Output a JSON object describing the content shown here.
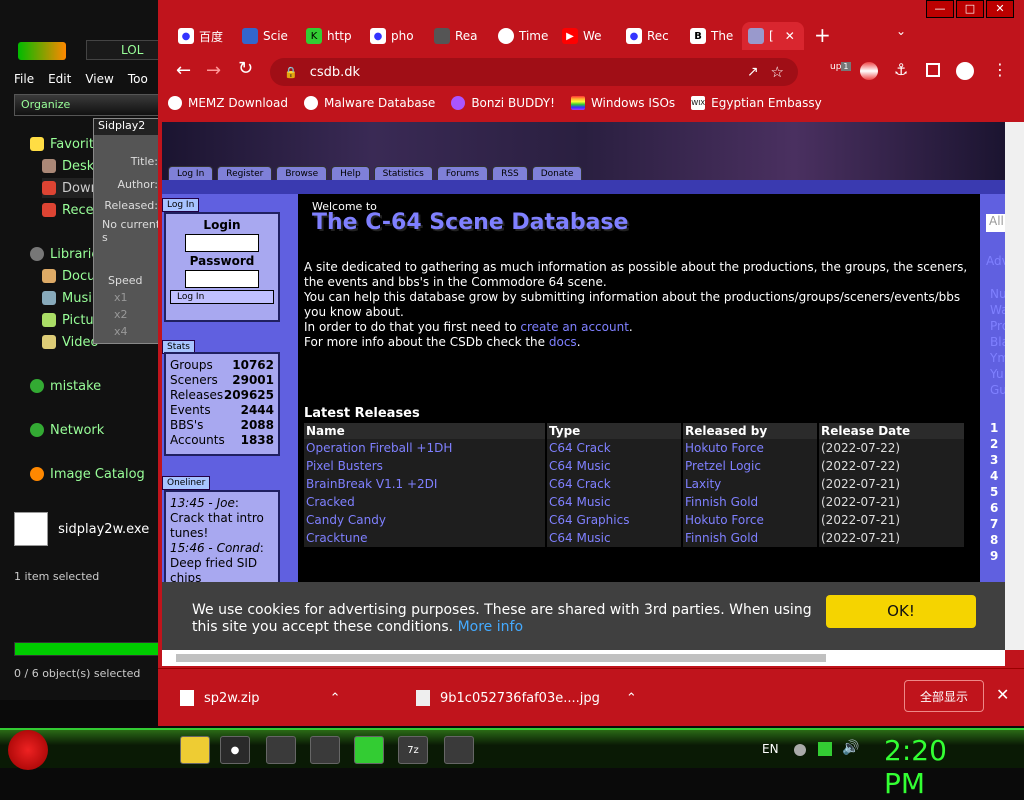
{
  "explorer": {
    "toolbar_text": "LOL",
    "menu": [
      "File",
      "Edit",
      "View",
      "Too"
    ],
    "organize": "Organize",
    "tree": [
      "Favorit",
      "Desk",
      "Down",
      "Rece",
      "Librarie",
      "Docu",
      "Musi",
      "Pictu",
      "Video",
      "mistake",
      "Network",
      "Image Catalog"
    ],
    "player_title": "Sidplay2",
    "player_labels": [
      "Title:",
      "Author:",
      "Released:",
      "No current s"
    ],
    "speed_label": "Speed",
    "speed_opts": [
      "x1",
      "x2",
      "x4"
    ],
    "file_name": "sidplay2w.exe",
    "status1": "1 item selected",
    "status2": "0 / 6 object(s) selected"
  },
  "browser": {
    "tabs": [
      "百度",
      "Scie",
      "http",
      "pho",
      "Rea",
      "Time",
      "We",
      "Rec",
      "The",
      "["
    ],
    "url": "csdb.dk",
    "bookmarks": [
      "MEMZ Download",
      "Malware Database",
      "Bonzi BUDDY!",
      "Windows ISOs",
      "Egyptian Embassy"
    ],
    "ext_badge": "1",
    "ext_label": "up",
    "colors": {
      "chrome": "#c0141c",
      "link": "#7f80ff",
      "cookie_btn": "#f5d400"
    }
  },
  "site": {
    "nav": [
      "Log In",
      "Register",
      "Browse",
      "Help",
      "Statistics",
      "Forums",
      "RSS",
      "Donate"
    ],
    "login_tab": "Log In",
    "login_label": "Login",
    "password_label": "Password",
    "login_button": "Log In",
    "stats_tab": "Stats",
    "stats": [
      {
        "label": "Groups",
        "value": "10762"
      },
      {
        "label": "Sceners",
        "value": "29001"
      },
      {
        "label": "Releases",
        "value": "209625"
      },
      {
        "label": "Events",
        "value": "2444"
      },
      {
        "label": "BBS's",
        "value": "2088"
      },
      {
        "label": "Accounts",
        "value": "1838"
      }
    ],
    "oneliner_tab": "Oneliner",
    "oneliner": [
      {
        "time": "13:45",
        "who": "Joe",
        "msg": "Crack that intro tunes!"
      },
      {
        "time": "15:46",
        "who": "Conrad",
        "msg": "Deep fried SID chips"
      }
    ],
    "welcome": "Welcome to",
    "title": "The C-64 Scene Database",
    "intro1": "A site dedicated to gathering as much information as possible about the productions, the groups, the sceners, the events and bbs's in the Commodore 64 scene.",
    "intro2": "You can help this database grow by submitting information about the productions/groups/sceners/events/bbs you know about.",
    "intro3_pre": "In order to do that you first need to",
    "intro3_link": "create an account",
    "intro4_pre": "For more info about the CSDb check the",
    "intro4_link": "docs",
    "releases_heading": "Latest Releases",
    "columns": [
      "Name",
      "Type",
      "Released by",
      "Release Date"
    ],
    "rows": [
      {
        "name": "Operation Fireball +1DH",
        "type": "C64 Crack",
        "by": "Hokuto Force",
        "date": "(2022-07-22)"
      },
      {
        "name": "Pixel Busters",
        "type": "C64 Music",
        "by": "Pretzel Logic",
        "date": "(2022-07-22)"
      },
      {
        "name": "BrainBreak V1.1 +2DI",
        "type": "C64 Crack",
        "by": "Laxity",
        "date": "(2022-07-21)"
      },
      {
        "name": "Cracked",
        "type": "C64 Music",
        "by": "Finnish Gold",
        "date": "(2022-07-21)"
      },
      {
        "name": "Candy Candy",
        "type": "C64 Graphics",
        "by": "Hokuto Force",
        "date": "(2022-07-21)"
      },
      {
        "name": "Cracktune",
        "type": "C64 Music",
        "by": "Finnish Gold",
        "date": "(2022-07-21)"
      }
    ],
    "right_fragments": [
      "All",
      "Adv",
      "Nu",
      "Wa",
      "Pro",
      "Bla",
      "Ym",
      "Yu",
      "Gu",
      "1",
      "2",
      "3",
      "4",
      "5",
      "6",
      "7",
      "8",
      "9"
    ]
  },
  "cookie": {
    "text": "We use cookies for advertising purposes. These are shared with 3rd parties. When using this site you accept these conditions.",
    "more": "More info",
    "ok": "OK!"
  },
  "downloads": {
    "items": [
      "sp2w.zip",
      "9b1c052736faf03e....jpg"
    ],
    "show_all": "全部显示"
  },
  "taskbar": {
    "lang": "EN",
    "clock": "2:20 PM"
  }
}
